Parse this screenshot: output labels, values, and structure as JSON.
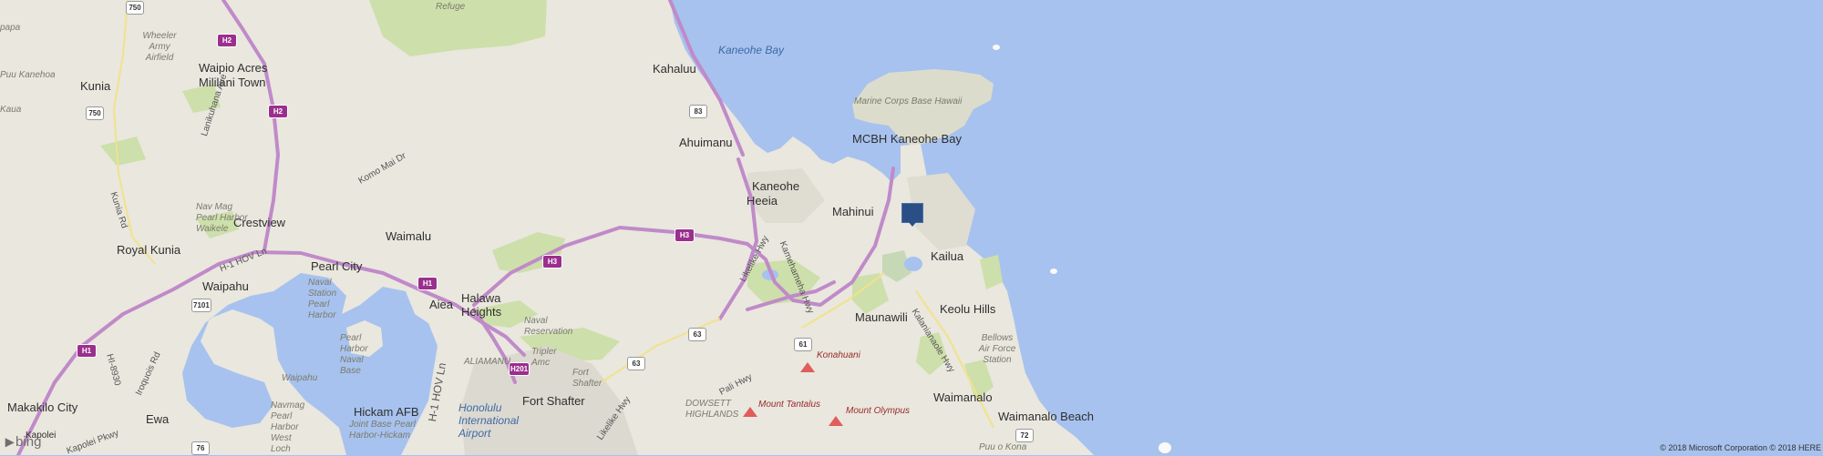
{
  "map": {
    "colors": {
      "water": "#a7c2ee",
      "land": "#e9e7de",
      "park": "#cddfaa",
      "freeway": "#c08ac9",
      "peak": "#e15c5c",
      "marker": "#2a4f86"
    },
    "places": [
      "Kunia",
      "Waipio Acres",
      "Mililani Town",
      "Crestview",
      "Royal Kunia",
      "Waipahu",
      "Pearl City",
      "Waimalu",
      "Aiea",
      "Halawa Heights",
      "Makakilo City",
      "Ewa",
      "Kapolei",
      "Hickam AFB",
      "Fort Shafter",
      "Kahaluu",
      "Ahuimanu",
      "Kaneohe",
      "Heeia",
      "Mahinui",
      "MCBH Kaneohe Bay",
      "Kailua",
      "Maunawili",
      "Keolu Hills",
      "Waimanalo",
      "Waimanalo Beach"
    ],
    "areas": [
      "Refuge",
      "Wheeler Army Airfield",
      "Puu Kanehoa",
      "Kaua",
      "Nav Mag Pearl Harbor Waikele",
      "Naval Station Pearl Harbor",
      "Pearl Harbor Naval Base",
      "Waipahu",
      "Naval Reservation",
      "Tripler Amc",
      "Fort Shafter",
      "ALIAMANU",
      "Navmag Pearl Harbor West Loch",
      "Joint Base Pearl Harbor-Hickam",
      "Marine Corps Base Hawaii",
      "Bellows Air Force Station",
      "DOWSETT HIGHLANDS",
      "Puu o Kona",
      "papa"
    ],
    "water": [
      "Kaneohe Bay"
    ],
    "airport": "Honolulu International Airport",
    "streets": [
      "Kunia Rd",
      "Lanikuhana Ave",
      "Komo Mai Dr",
      "H-1 HOV Ln",
      "Likelike Hwy",
      "Kamehameha Hwy",
      "Kalanianaole Hwy",
      "Pali Hwy",
      "Iroquois Rd",
      "Kapolei Pkwy",
      "HI-8930"
    ],
    "shields": [
      "750",
      "H2",
      "H2",
      "750",
      "H1",
      "H1",
      "H3",
      "H3",
      "H201",
      "83",
      "7101",
      "63",
      "63",
      "61",
      "72",
      "76"
    ],
    "peaks": [
      "Konahuani",
      "Mount Tantalus",
      "Mount Olympus"
    ],
    "copyright": "© 2018 Microsoft Corporation © 2018 HERE",
    "brand": "bing"
  }
}
